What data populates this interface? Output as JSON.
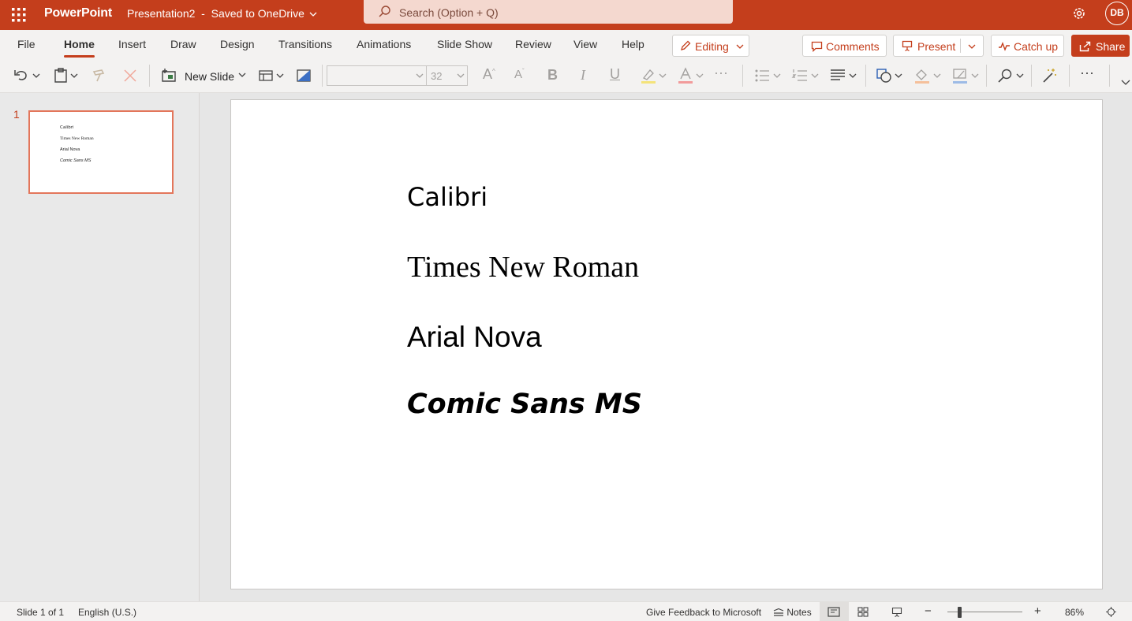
{
  "titlebar": {
    "app_name": "PowerPoint",
    "doc_title": "Presentation2",
    "save_status": "Saved to OneDrive",
    "search_placeholder": "Search (Option + Q)",
    "avatar_initials": "DB",
    "brand_color": "#c43e1c"
  },
  "tabs": [
    {
      "label": "File"
    },
    {
      "label": "Home"
    },
    {
      "label": "Insert"
    },
    {
      "label": "Draw"
    },
    {
      "label": "Design"
    },
    {
      "label": "Transitions"
    },
    {
      "label": "Animations"
    },
    {
      "label": "Slide Show"
    },
    {
      "label": "Review"
    },
    {
      "label": "View"
    },
    {
      "label": "Help"
    }
  ],
  "active_tab": "Home",
  "ribbon_buttons": {
    "editing": "Editing",
    "comments": "Comments",
    "present": "Present",
    "catch_up": "Catch up",
    "share": "Share"
  },
  "toolbar": {
    "new_slide": "New Slide",
    "font_name": "",
    "font_size": "32"
  },
  "slides_pane": {
    "slide_number": "1",
    "thumb_lines": [
      "Calibri",
      "Times New Roman",
      "Arial Nova",
      "Comic Sans MS"
    ]
  },
  "slide": {
    "lines": [
      "Calibri",
      "Times New Roman",
      "Arial Nova",
      "Comic Sans MS"
    ]
  },
  "statusbar": {
    "slide_info": "Slide 1 of 1",
    "language": "English (U.S.)",
    "feedback": "Give Feedback to Microsoft",
    "notes": "Notes",
    "zoom": "86%",
    "zoom_level": 0.86
  }
}
